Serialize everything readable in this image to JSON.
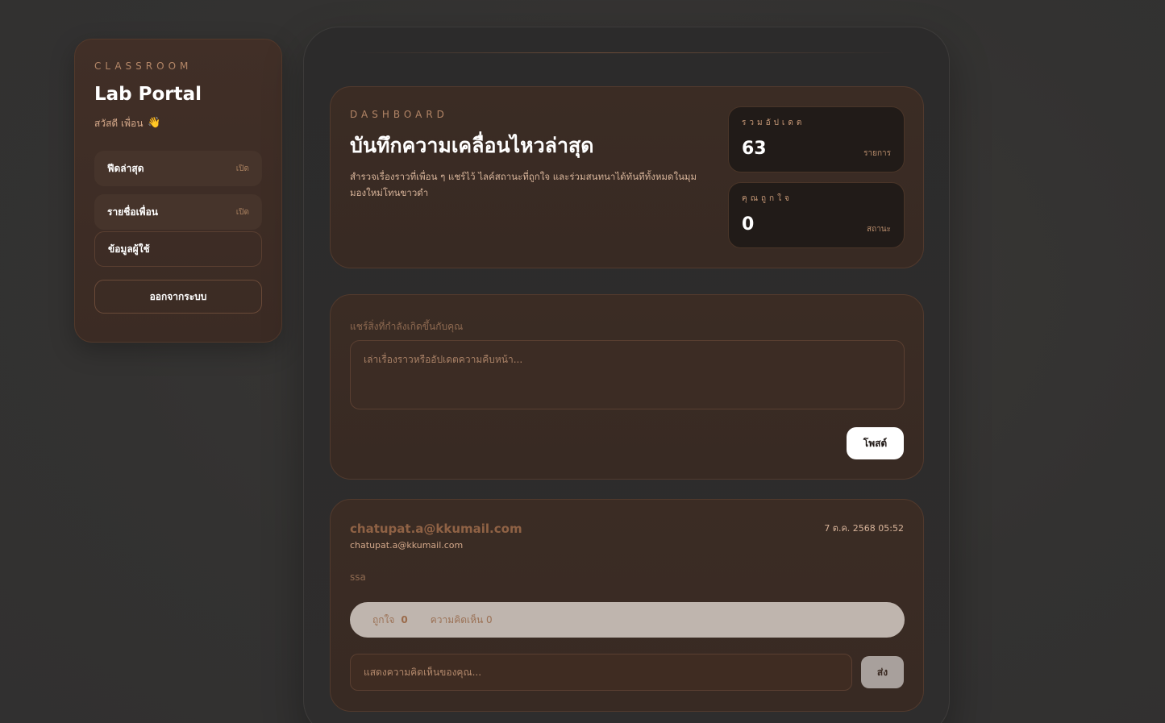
{
  "sidebar": {
    "eyebrow": "CLASSROOM",
    "title": "Lab Portal",
    "greeting": "สวัสดี เพื่อน",
    "greeting_emoji": "👋",
    "items": [
      {
        "label": "ฟีดล่าสุด",
        "state": "เปิด"
      },
      {
        "label": "รายชื่อเพื่อน",
        "state": "เปิด"
      },
      {
        "label": "ข้อมูลผู้ใช้"
      }
    ],
    "logout_label": "ออกจากระบบ"
  },
  "dashboard": {
    "eyebrow": "DASHBOARD",
    "title": "บันทึกความเคลื่อนไหวล่าสุด",
    "description": "สำรวจเรื่องราวที่เพื่อน ๆ แชร์ไว้ ไลค์สถานะที่ถูกใจ และร่วมสนทนาได้ทันทีทั้งหมดในมุมมองใหม่โทนขาวดำ",
    "stats": [
      {
        "label": "รวมอัปเดต",
        "value": "63",
        "unit": "รายการ"
      },
      {
        "label": "คุณถูกใจ",
        "value": "0",
        "unit": "สถานะ"
      }
    ]
  },
  "composer": {
    "label": "แชร์สิ่งที่กำลังเกิดขึ้นกับคุณ",
    "placeholder": "เล่าเรื่องราวหรืออัปเดตความคืบหน้า...",
    "post_label": "โพสต์"
  },
  "post": {
    "author": "chatupat.a@kkumail.com",
    "email": "chatupat.a@kkumail.com",
    "timestamp": "7 ต.ค. 2568 05:52",
    "body": "ssa",
    "like_label": "ถูกใจ",
    "like_count": "0",
    "comment_label": "ความคิดเห็น 0",
    "comment_placeholder": "แสดงความคิดเห็นของคุณ...",
    "send_label": "ส่ง"
  }
}
